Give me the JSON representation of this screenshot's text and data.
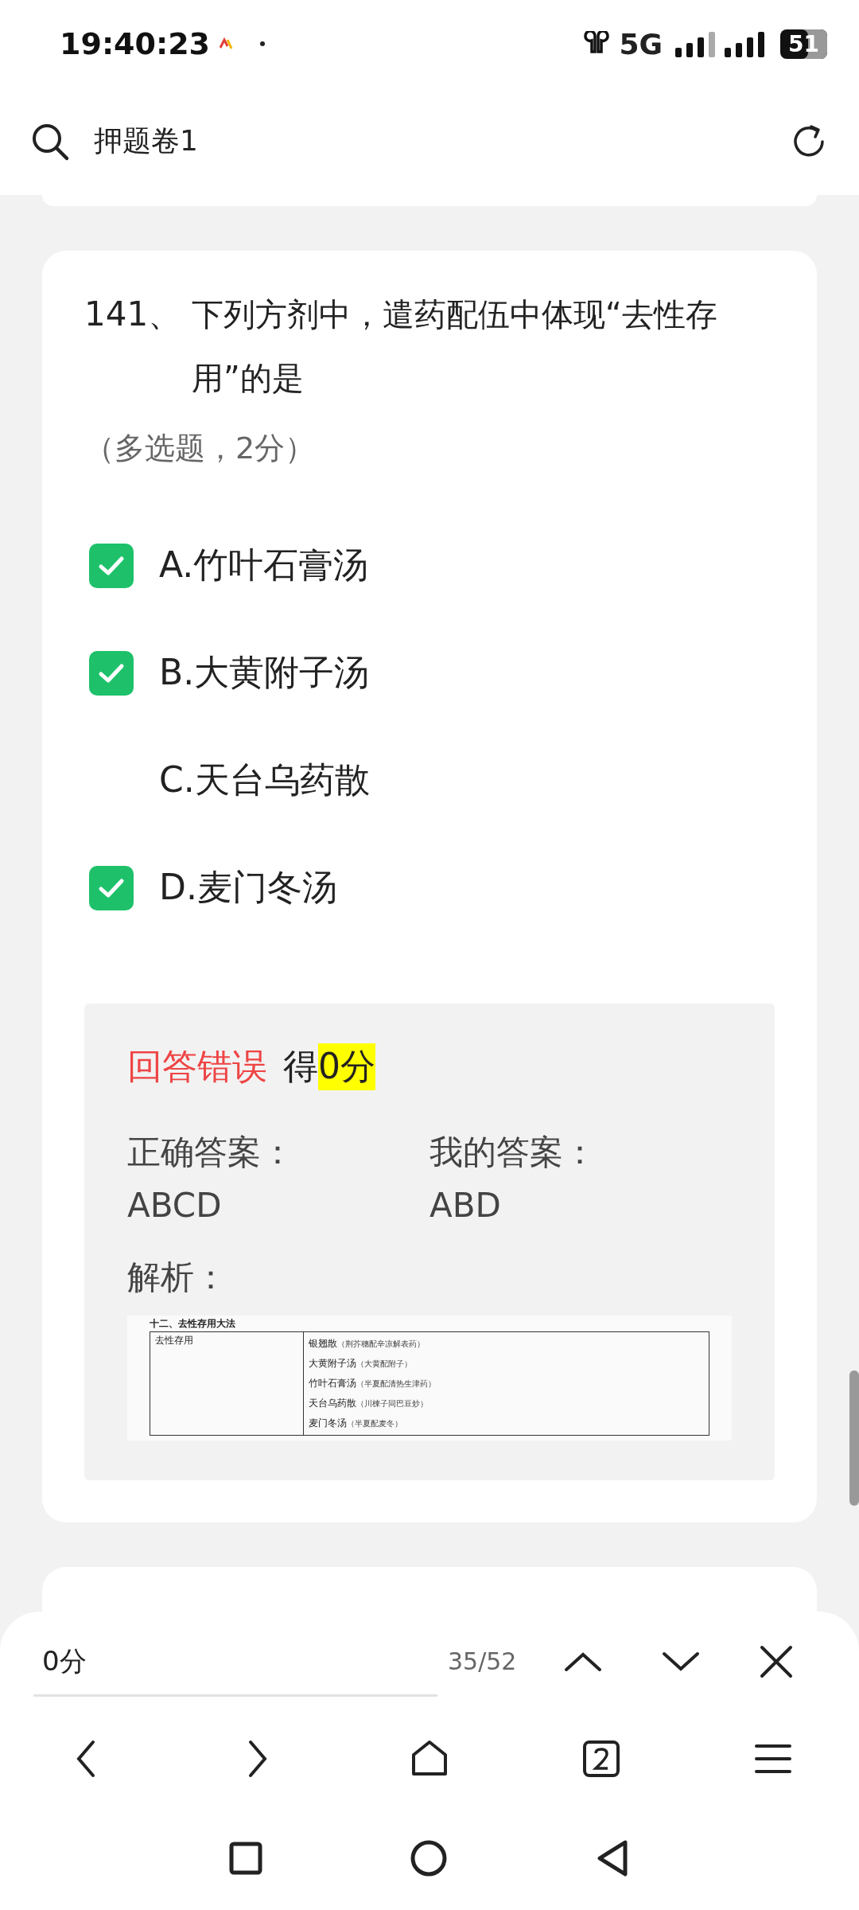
{
  "status_bar": {
    "time": "19:40:23",
    "network": "5G",
    "battery": "51"
  },
  "header": {
    "title": "押题卷1"
  },
  "question": {
    "number": "141、",
    "text": "下列方剂中，遣药配伍中体现“去性存用”的是",
    "meta": "（多选题，2分）",
    "options": [
      {
        "label": "A.竹叶石膏汤",
        "checked": true
      },
      {
        "label": "B.大黄附子汤",
        "checked": true
      },
      {
        "label": "C.天台乌药散",
        "checked": false
      },
      {
        "label": "D.麦门冬汤",
        "checked": true
      }
    ],
    "result": {
      "verdict": "回答错误",
      "score_prefix": "得",
      "score": "0分",
      "correct_label": "正确答案：",
      "correct": "ABCD",
      "mine_label": "我的答案：",
      "mine": "ABD",
      "analysis_label": "解析：",
      "analysis_table": {
        "title": "十二、去性存用大法",
        "category": "去性存用",
        "items": [
          {
            "name": "银翘散",
            "note": "（荆芥穗配辛凉解表药）"
          },
          {
            "name": "大黄附子汤",
            "note": "（大黄配附子）"
          },
          {
            "name": "竹叶石膏汤",
            "note": "（半夏配清热生津药）"
          },
          {
            "name": "天台乌药散",
            "note": "（川楝子同巴豆炒）"
          },
          {
            "name": "麦门冬汤",
            "note": "（半夏配麦冬）"
          }
        ]
      }
    }
  },
  "find_bar": {
    "score": "0分",
    "position": "35/52"
  }
}
